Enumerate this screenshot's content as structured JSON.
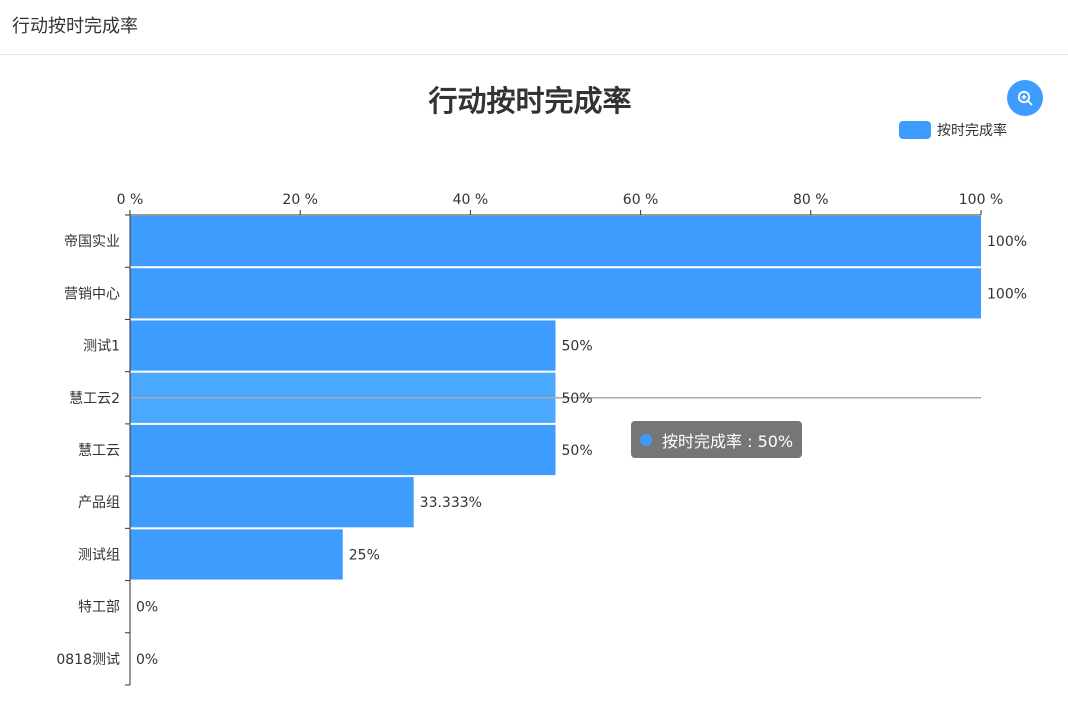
{
  "header": {
    "title": "行动按时完成率"
  },
  "tooltip": {
    "text": "按时完成率 : 50%"
  },
  "colors": {
    "bar": "#3f9cff",
    "bar_highlight": "#4aa9ff",
    "axis": "#333333",
    "pointer": "#aaaaaa"
  },
  "chart_data": {
    "type": "bar",
    "orientation": "horizontal",
    "title": "行动按时完成率",
    "legend": [
      "按时完成率"
    ],
    "legend_position": "top-right",
    "categories": [
      "帝国实业",
      "营销中心",
      "测试1",
      "慧工云2",
      "慧工云",
      "产品组",
      "测试组",
      "特工部",
      "0818测试"
    ],
    "series": [
      {
        "name": "按时完成率",
        "values": [
          100,
          100,
          50,
          50,
          50,
          33.333,
          25,
          0,
          0
        ],
        "labels": [
          "100%",
          "100%",
          "50%",
          "50%",
          "50%",
          "33.333%",
          "25%",
          "0%",
          "0%"
        ]
      }
    ],
    "xlim": [
      0,
      100
    ],
    "xticks": [
      0,
      20,
      40,
      60,
      80,
      100
    ],
    "xtick_labels": [
      "0 %",
      "20 %",
      "40 %",
      "60 %",
      "80 %",
      "100 %"
    ],
    "x_axis_position": "top",
    "highlighted_category": "慧工云2",
    "grid": false
  }
}
